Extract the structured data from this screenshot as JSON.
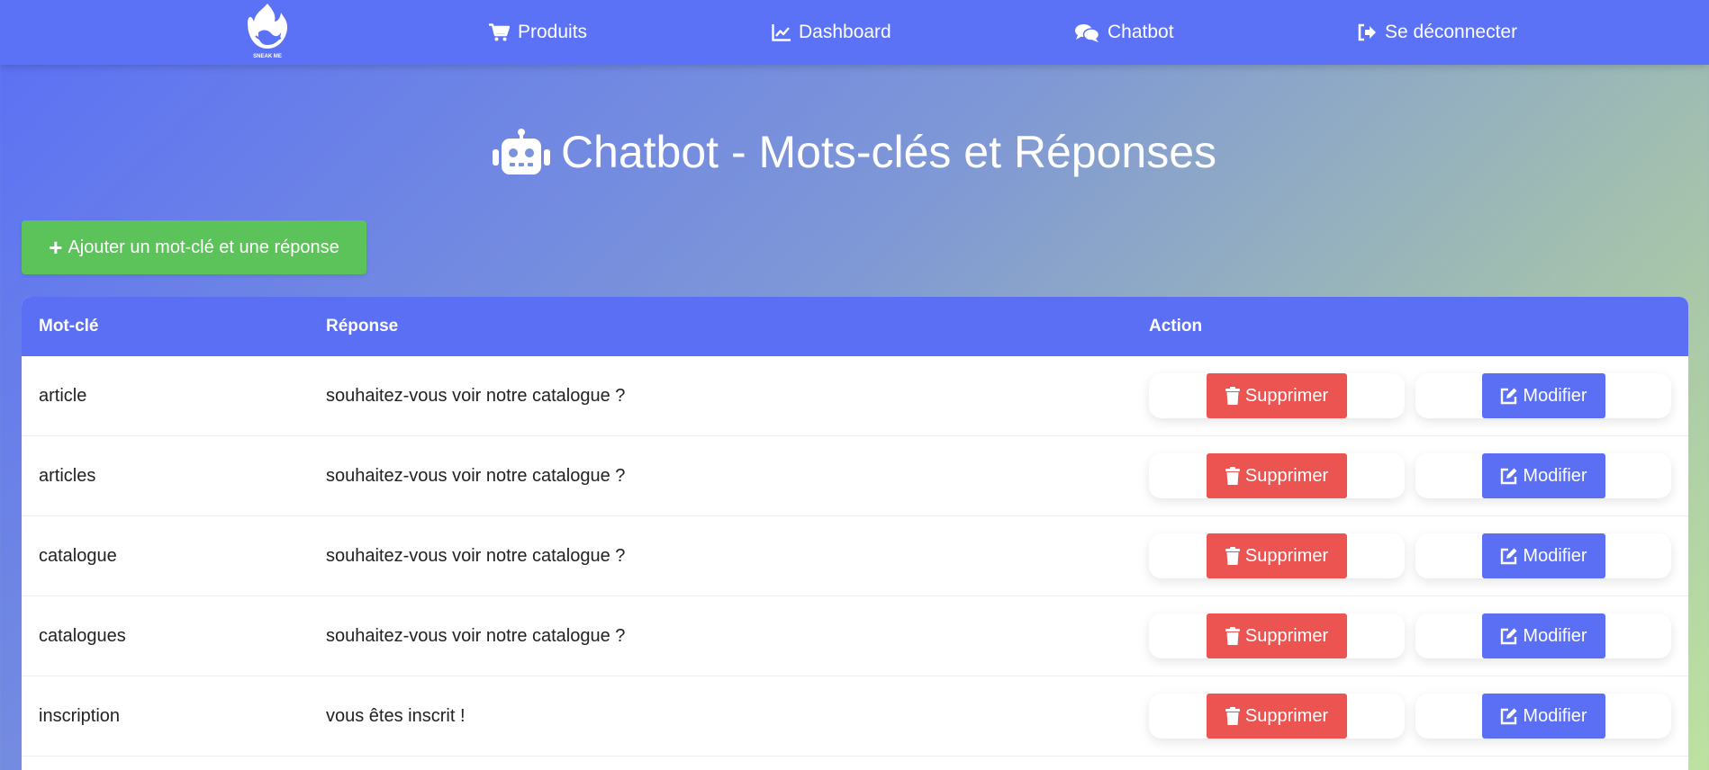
{
  "nav": {
    "logo_text": "SNEAK ME",
    "items": [
      {
        "label": "Produits",
        "icon": "cart-icon"
      },
      {
        "label": "Dashboard",
        "icon": "line-chart-icon"
      },
      {
        "label": "Chatbot",
        "icon": "chat-bubbles-icon"
      },
      {
        "label": "Se déconnecter",
        "icon": "sign-out-icon"
      }
    ]
  },
  "page": {
    "title": "Chatbot - Mots-clés et Réponses",
    "title_icon": "robot-icon"
  },
  "add_button": {
    "label": "Ajouter un mot-clé et une réponse",
    "icon": "plus-icon"
  },
  "table": {
    "headers": {
      "keyword": "Mot-clé",
      "response": "Réponse",
      "action": "Action"
    },
    "rows": [
      {
        "keyword": "article",
        "response": "souhaitez-vous voir notre catalogue ?"
      },
      {
        "keyword": "articles",
        "response": "souhaitez-vous voir notre catalogue ?"
      },
      {
        "keyword": "catalogue",
        "response": "souhaitez-vous voir notre catalogue ?"
      },
      {
        "keyword": "catalogues",
        "response": "souhaitez-vous voir notre catalogue ?"
      },
      {
        "keyword": "inscription",
        "response": "vous êtes inscrit !"
      }
    ],
    "delete_label": "Supprimer",
    "edit_label": "Modifier"
  },
  "colors": {
    "nav": "#5b72f6",
    "primary": "#5b6ff5",
    "success": "#5cc25a",
    "danger": "#ec5451"
  }
}
